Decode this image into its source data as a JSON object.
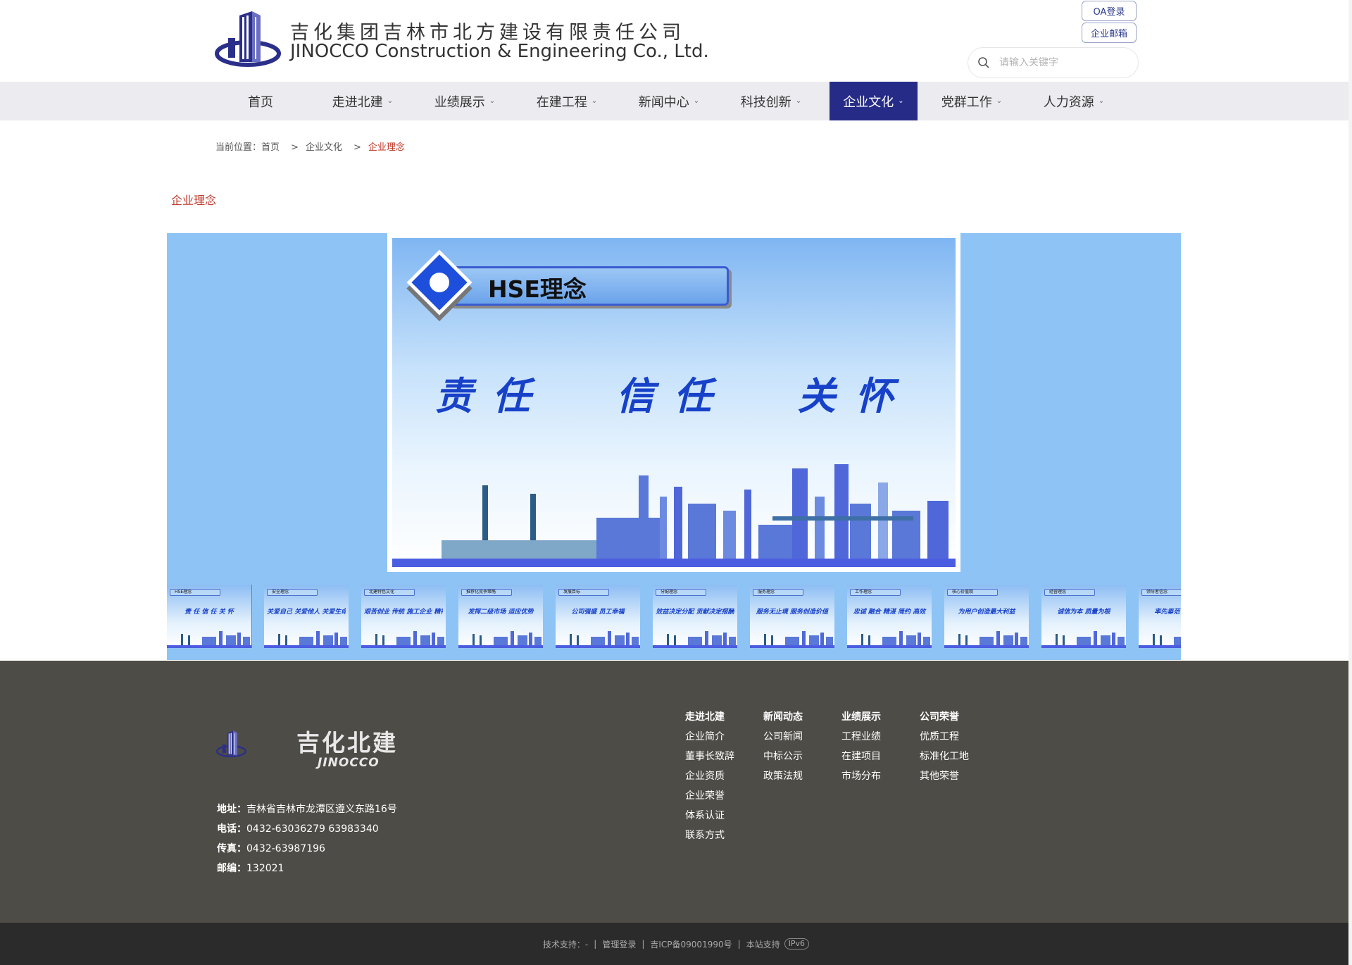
{
  "header": {
    "company_cn": "吉化集团吉林市北方建设有限责任公司",
    "company_en": "JINOCCO Construction & Engineering Co., Ltd.",
    "oa_login": "OA登录",
    "enterprise_mail": "企业邮箱",
    "search_placeholder": "请输入关键字",
    "logo_icon": "building-logo-icon",
    "search_icon": "search-icon"
  },
  "nav": {
    "items": [
      {
        "label": "首页",
        "has_dropdown": false
      },
      {
        "label": "走进北建",
        "has_dropdown": true
      },
      {
        "label": "业绩展示",
        "has_dropdown": true
      },
      {
        "label": "在建工程",
        "has_dropdown": true
      },
      {
        "label": "新闻中心",
        "has_dropdown": true
      },
      {
        "label": "科技创新",
        "has_dropdown": true
      },
      {
        "label": "企业文化",
        "has_dropdown": true,
        "active": true
      },
      {
        "label": "党群工作",
        "has_dropdown": true
      },
      {
        "label": "人力资源",
        "has_dropdown": true
      }
    ],
    "active_color": "#252b86"
  },
  "breadcrumb": {
    "prefix": "当前位置：",
    "home": "首页",
    "sep": ">",
    "parent": "企业文化",
    "current": "企业理念"
  },
  "section_title": "企业理念",
  "gallery": {
    "background": "#8ec4f5",
    "main_slide": {
      "title": "HSE理念",
      "motto": "责任  信任  关怀"
    },
    "thumbs": [
      {
        "label": "HSE理念",
        "text": "责 任  信 任  关 怀",
        "active": true
      },
      {
        "label": "安全理念",
        "text": "关爱自己 关爱他人 关爱生命",
        "active": false
      },
      {
        "label": "北建特色文化",
        "text": "艰苦创业 传统 施工企业 精神",
        "active": false
      },
      {
        "label": "推荐化竞争策略",
        "text": "发挥二级市场 适应优势",
        "active": false
      },
      {
        "label": "发展目标",
        "text": "公司强盛 员工幸福",
        "active": false
      },
      {
        "label": "分配理念",
        "text": "效益决定分配 贡献决定报酬",
        "active": false
      },
      {
        "label": "服务理念",
        "text": "服务无止境 服务创造价值",
        "active": false
      },
      {
        "label": "工作理念",
        "text": "忠诚 融合 精湛 简约 高效",
        "active": false
      },
      {
        "label": "核心价值观",
        "text": "为用户创造最大利益",
        "active": false
      },
      {
        "label": "经营理念",
        "text": "诚信为本 质量为根",
        "active": false
      },
      {
        "label": "领导者信念",
        "text": "率先垂范 躬身先行",
        "active": false
      }
    ]
  },
  "footer": {
    "brand_cn": "吉化北建",
    "brand_en": "JINOCCO",
    "contact": [
      {
        "label": "地址：",
        "value": "吉林省吉林市龙潭区遵义东路16号"
      },
      {
        "label": "电话：",
        "value": "0432-63036279 63983340"
      },
      {
        "label": "传真：",
        "value": "0432-63987196"
      },
      {
        "label": "邮编：",
        "value": "132021"
      }
    ],
    "columns": [
      {
        "head": "走进北建",
        "items": [
          "企业简介",
          "董事长致辞",
          "企业资质",
          "企业荣誉",
          "体系认证",
          "联系方式"
        ]
      },
      {
        "head": "新闻动态",
        "items": [
          "公司新闻",
          "中标公示",
          "政策法规"
        ]
      },
      {
        "head": "业绩展示",
        "items": [
          "工程业绩",
          "在建项目",
          "市场分布"
        ]
      },
      {
        "head": "公司荣誉",
        "items": [
          "优质工程",
          "标准化工地",
          "其他荣誉"
        ]
      }
    ]
  },
  "bottom_bar": {
    "tech_support": "技术支持：-",
    "admin_login": "管理登录",
    "icp": "吉ICP备09001990号",
    "site_support": "本站支持",
    "ipv6": "IPv6"
  }
}
